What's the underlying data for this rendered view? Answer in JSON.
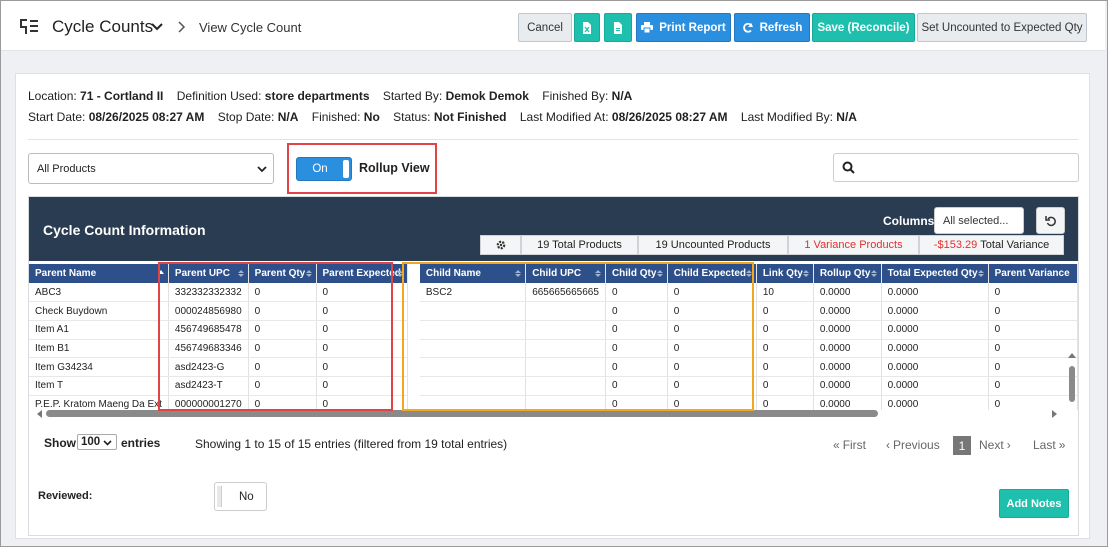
{
  "header": {
    "app_title": "Cycle Counts",
    "breadcrumb": "View Cycle Count",
    "buttons": {
      "cancel": "Cancel",
      "print_report": "Print Report",
      "refresh": "Refresh",
      "save_reconcile": "Save (Reconcile)",
      "set_uncounted": "Set Uncounted to Expected Qty"
    }
  },
  "info": {
    "location_label": "Location:",
    "location_value": "71 - Cortland II",
    "definition_label": "Definition Used:",
    "definition_value": "store departments",
    "started_by_label": "Started By:",
    "started_by_value": "Demok Demok",
    "finished_by_label": "Finished By:",
    "finished_by_value": "N/A",
    "start_date_label": "Start Date:",
    "start_date_value": "08/26/2025 08:27 AM",
    "stop_date_label": "Stop Date:",
    "stop_date_value": "N/A",
    "finished_label": "Finished:",
    "finished_value": "No",
    "status_label": "Status:",
    "status_value": "Not Finished",
    "last_modified_at_label": "Last Modified At:",
    "last_modified_at_value": "08/26/2025 08:27 AM",
    "last_modified_by_label": "Last Modified By:",
    "last_modified_by_value": "N/A"
  },
  "filters": {
    "product_filter": "All Products",
    "rollup_toggle": "On",
    "rollup_label": "Rollup View",
    "search_placeholder": ""
  },
  "panel": {
    "title": "Cycle Count Information",
    "columns_label": "Columns",
    "columns_value": "All selected...",
    "stats": {
      "total_products": "19 Total Products",
      "uncounted_products": "19 Uncounted Products",
      "variance_products": "1 Variance Products",
      "total_variance_amount": "-$153.29",
      "total_variance_label": "Total Variance"
    }
  },
  "table": {
    "columns": [
      "Parent Name",
      "Parent UPC",
      "Parent Qty",
      "Parent Expected",
      "Child Name",
      "Child UPC",
      "Child Qty",
      "Child Expected",
      "Link Qty",
      "Rollup Qty",
      "Total Expected Qty",
      "Parent Variance"
    ],
    "rows": [
      [
        "ABC3",
        "332332332332",
        "0",
        "0",
        "BSC2",
        "665665665665",
        "0",
        "0",
        "10",
        "0.0000",
        "0.0000",
        "0"
      ],
      [
        "Check Buydown",
        "000024856980",
        "0",
        "0",
        "",
        "",
        "0",
        "0",
        "0",
        "0.0000",
        "0.0000",
        "0"
      ],
      [
        "Item A1",
        "456749685478",
        "0",
        "0",
        "",
        "",
        "0",
        "0",
        "0",
        "0.0000",
        "0.0000",
        "0"
      ],
      [
        "Item B1",
        "456749683346",
        "0",
        "0",
        "",
        "",
        "0",
        "0",
        "0",
        "0.0000",
        "0.0000",
        "0"
      ],
      [
        "Item G34234",
        "asd2423-G",
        "0",
        "0",
        "",
        "",
        "0",
        "0",
        "0",
        "0.0000",
        "0.0000",
        "0"
      ],
      [
        "Item T",
        "asd2423-T",
        "0",
        "0",
        "",
        "",
        "0",
        "0",
        "0",
        "0.0000",
        "0.0000",
        "0"
      ],
      [
        "P.E.P. Kratom Maeng Da Ext",
        "000000001270",
        "0",
        "0",
        "",
        "",
        "0",
        "0",
        "0",
        "0.0000",
        "0.0000",
        "0"
      ]
    ]
  },
  "footer": {
    "show_label": "Show",
    "entries_value": "100",
    "entries_label": "entries",
    "summary": "Showing 1 to 15 of 15 entries (filtered from 19 total entries)",
    "pager": {
      "first": "First",
      "previous": "Previous",
      "current": "1",
      "next": "Next",
      "last": "Last"
    },
    "reviewed_label": "Reviewed:",
    "reviewed_value": "No",
    "add_notes": "Add Notes"
  },
  "colors": {
    "teal": "#1fbfae",
    "blue": "#2b8fe0",
    "panel_header": "#2a3c52",
    "table_header": "#2d4f8a",
    "highlight_red": "#e04444",
    "highlight_orange": "#f0a823",
    "variance_red": "#e03030"
  }
}
